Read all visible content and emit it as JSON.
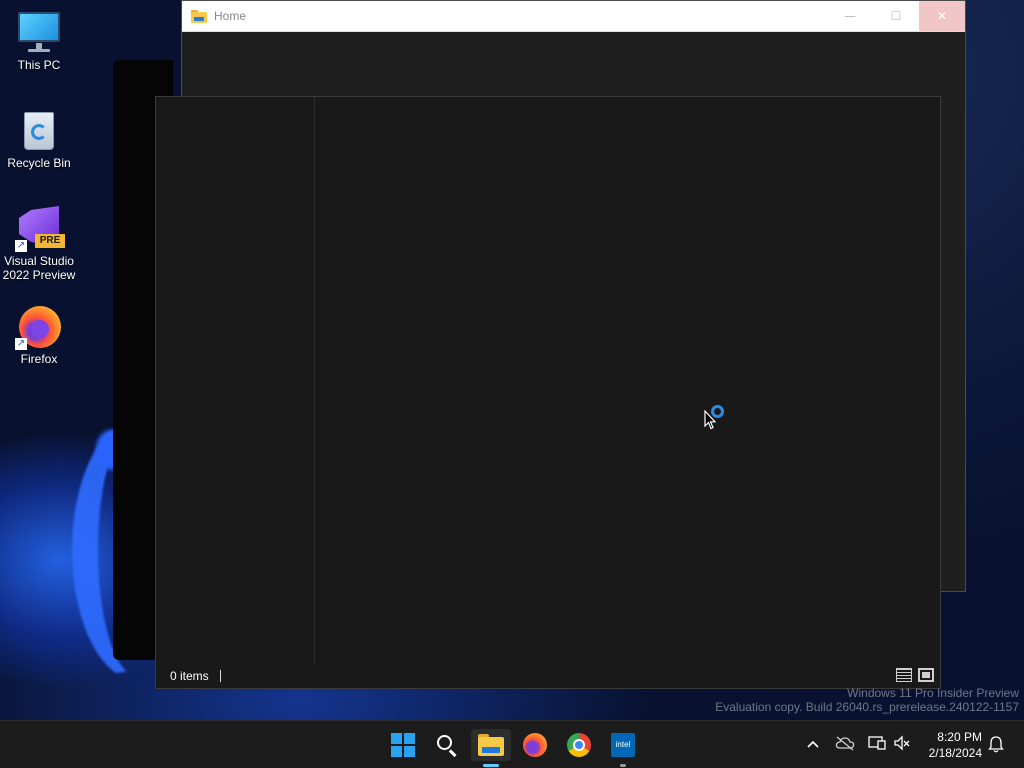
{
  "desktop": {
    "icons": [
      {
        "label": "This PC"
      },
      {
        "label": "Recycle Bin"
      },
      {
        "label": "Visual Studio 2022 Preview",
        "badge": "PRE"
      },
      {
        "label": "Firefox"
      }
    ]
  },
  "back_window": {
    "title": "Home",
    "minimize_glyph": "—",
    "maximize_glyph": "☐",
    "close_glyph": "✕"
  },
  "explorer": {
    "status_text": "0 items",
    "views": [
      "details-view",
      "large-icons-view"
    ]
  },
  "watermark": {
    "line1": "Windows 11 Pro Insider Preview",
    "line2": "Evaluation copy. Build 26040.rs_prerelease.240122-1157"
  },
  "taskbar": {
    "apps": [
      {
        "name": "start",
        "icon": "windows-logo-icon"
      },
      {
        "name": "search",
        "icon": "search-icon"
      },
      {
        "name": "file-explorer",
        "icon": "folder-icon",
        "active": true
      },
      {
        "name": "firefox",
        "icon": "firefox-icon"
      },
      {
        "name": "chrome",
        "icon": "chrome-icon"
      },
      {
        "name": "intel",
        "icon": "intel-icon",
        "label": "intel"
      }
    ],
    "tray": {
      "chevron": "^",
      "time": "8:20 PM",
      "date": "2/18/2024"
    }
  },
  "colors": {
    "accent": "#60cdff",
    "busy_ring": "#2a8be8",
    "window_bg": "#191919"
  }
}
